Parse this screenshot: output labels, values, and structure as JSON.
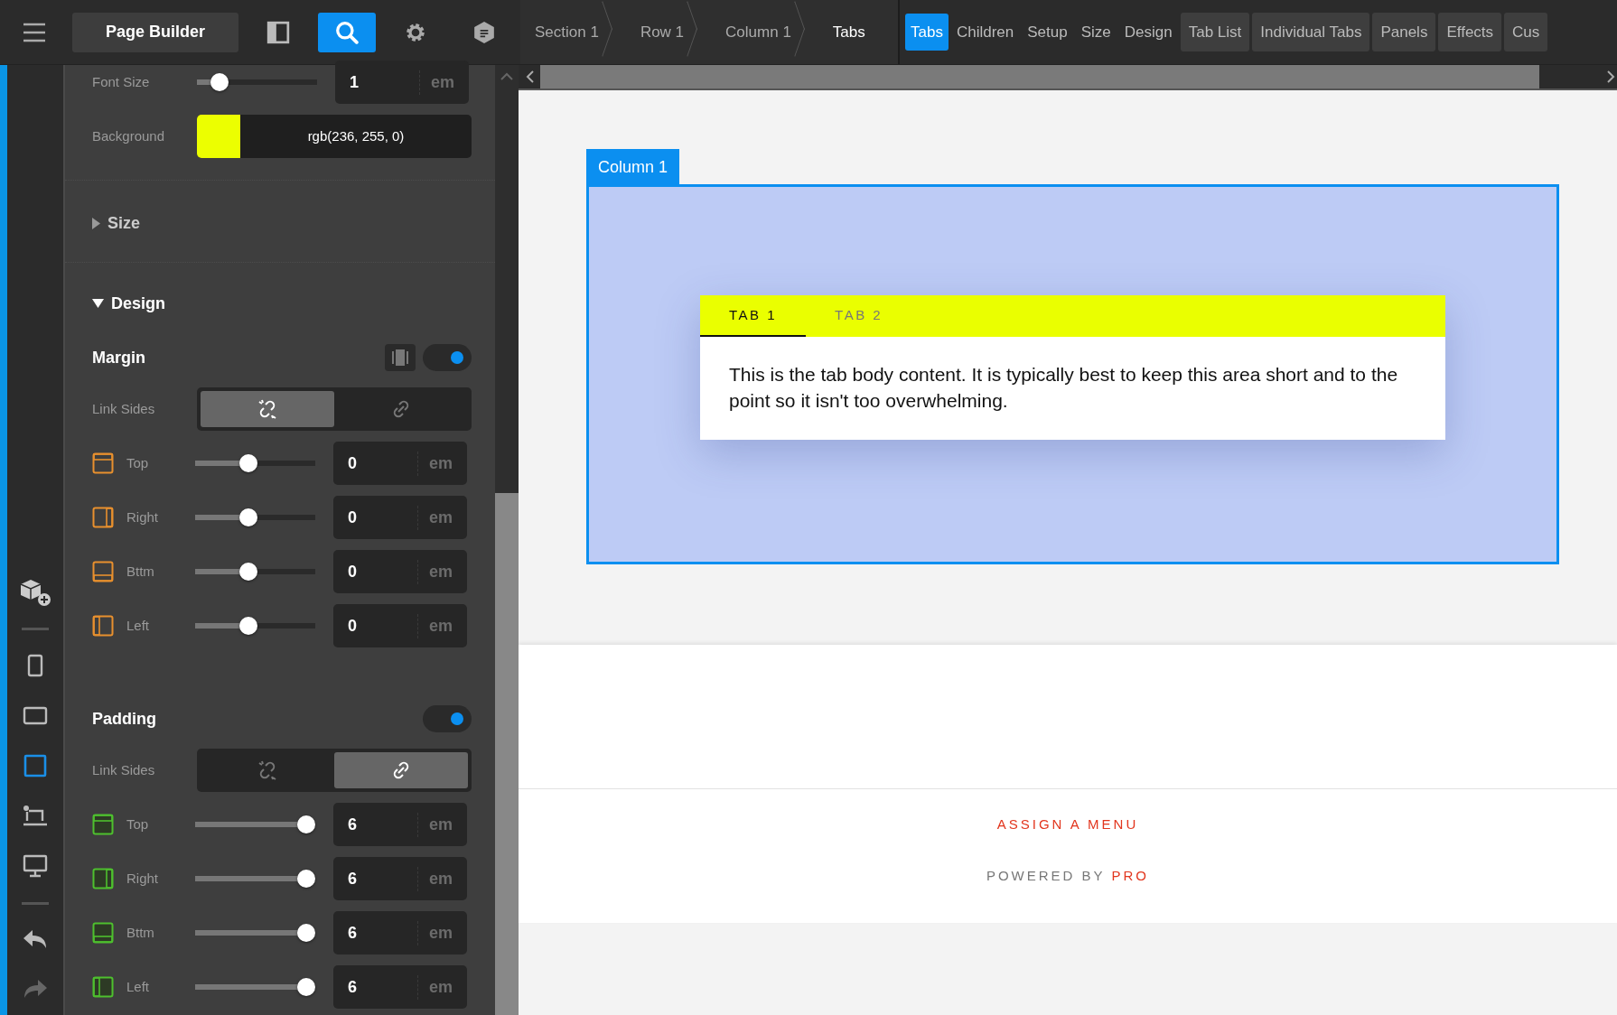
{
  "toolbar": {
    "title": "Page Builder",
    "tools": [
      {
        "kind": "layout",
        "selected": false
      },
      {
        "kind": "search",
        "selected": true
      },
      {
        "kind": "settings",
        "selected": false
      },
      {
        "kind": "shield",
        "selected": false
      }
    ]
  },
  "breadcrumbs": [
    "Section 1",
    "Row 1",
    "Column 1",
    "Tabs"
  ],
  "inspector_tabs": [
    {
      "label": "Tabs",
      "kind": "plain",
      "selected": true
    },
    {
      "label": "Children",
      "kind": "plain",
      "selected": false
    },
    {
      "label": "Setup",
      "kind": "plain",
      "selected": false
    },
    {
      "label": "Size",
      "kind": "plain",
      "selected": false
    },
    {
      "label": "Design",
      "kind": "plain",
      "selected": false
    },
    {
      "label": "Tab List",
      "kind": "group",
      "selected": false
    },
    {
      "label": "Individual Tabs",
      "kind": "group",
      "selected": false
    },
    {
      "label": "Panels",
      "kind": "group",
      "selected": false
    },
    {
      "label": "Effects",
      "kind": "group",
      "selected": false
    },
    {
      "label": "Cus",
      "kind": "group",
      "selected": false
    }
  ],
  "rail": {
    "devices": [
      {
        "kind": "phone",
        "selected": false
      },
      {
        "kind": "tablet",
        "selected": false
      },
      {
        "kind": "square",
        "selected": true
      },
      {
        "kind": "laptop",
        "selected": false
      },
      {
        "kind": "desktop",
        "selected": false
      }
    ]
  },
  "panel": {
    "font_size": {
      "label": "Font Size",
      "level": 0.13,
      "value": "1",
      "unit": "em"
    },
    "background": {
      "label": "Background",
      "color": "#ecff00",
      "value": "rgb(236, 255, 0)"
    },
    "sections": [
      {
        "label": "Size",
        "expanded": false
      },
      {
        "label": "Design",
        "expanded": true
      }
    ],
    "groups": [
      {
        "title": "Margin",
        "kind": "margin",
        "on": true,
        "link_label": "Link Sides",
        "linked": false,
        "sides": [
          {
            "label": "Top",
            "level": 0.43,
            "value": "0",
            "unit": "em"
          },
          {
            "label": "Right",
            "level": 0.43,
            "value": "0",
            "unit": "em"
          },
          {
            "label": "Bttm",
            "level": 0.43,
            "value": "0",
            "unit": "em"
          },
          {
            "label": "Left",
            "level": 0.43,
            "value": "0",
            "unit": "em"
          }
        ]
      },
      {
        "title": "Padding",
        "kind": "padding",
        "on": true,
        "link_label": "Link Sides",
        "linked": true,
        "sides": [
          {
            "label": "Top",
            "level": 1,
            "value": "6",
            "unit": "em"
          },
          {
            "label": "Right",
            "level": 1,
            "value": "6",
            "unit": "em"
          },
          {
            "label": "Bttm",
            "level": 1,
            "value": "6",
            "unit": "em"
          },
          {
            "label": "Left",
            "level": 1,
            "value": "6",
            "unit": "em"
          }
        ]
      }
    ]
  },
  "canvas": {
    "column_label": "Column 1",
    "tabs": [
      {
        "label": "TAB 1",
        "selected": true
      },
      {
        "label": "TAB 2",
        "selected": false
      }
    ],
    "body": "This is the tab body content. It is typically best to keep this area short and to the point so it isn't too overwhelming.",
    "footer": {
      "menu_link": "ASSIGN A MENU",
      "powered_by": "POWERED BY",
      "brand": "PRO"
    }
  }
}
